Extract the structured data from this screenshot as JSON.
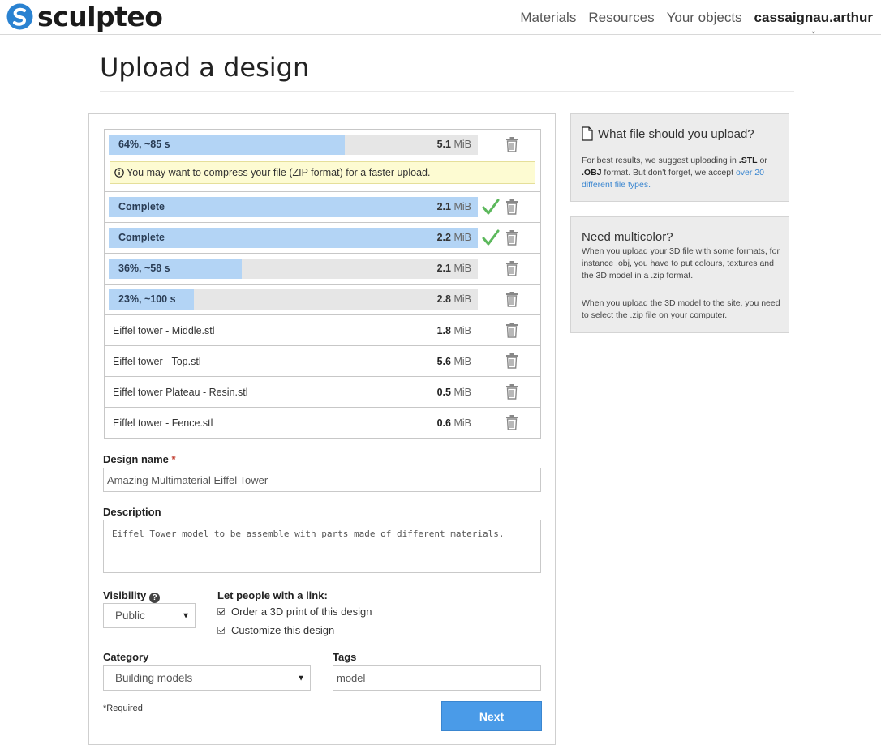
{
  "brand": {
    "name": "sculpteo",
    "color": "#2a82d1"
  },
  "nav": {
    "items": [
      "Materials",
      "Resources",
      "Your objects"
    ],
    "user": "cassaignau.arthur"
  },
  "page": {
    "title": "Upload a design"
  },
  "files": [
    {
      "status": "64%, ~85 s",
      "size_num": "5.1",
      "size_unit": "MiB",
      "progress": 0.64,
      "warning": "You may want to compress your file (ZIP format) for a faster upload."
    },
    {
      "status": "Complete",
      "size_num": "2.1",
      "size_unit": "MiB",
      "progress": 1.0,
      "done": true
    },
    {
      "status": "Complete",
      "size_num": "2.2",
      "size_unit": "MiB",
      "progress": 1.0,
      "done": true
    },
    {
      "status": "36%, ~58 s",
      "size_num": "2.1",
      "size_unit": "MiB",
      "progress": 0.36
    },
    {
      "status": "23%, ~100 s",
      "size_num": "2.8",
      "size_unit": "MiB",
      "progress": 0.23
    },
    {
      "name": "Eiffel tower - Middle.stl",
      "size_num": "1.8",
      "size_unit": "MiB"
    },
    {
      "name": "Eiffel tower - Top.stl",
      "size_num": "5.6",
      "size_unit": "MiB"
    },
    {
      "name": "Eiffel tower Plateau - Resin.stl",
      "size_num": "0.5",
      "size_unit": "MiB"
    },
    {
      "name": "Eiffel tower - Fence.stl",
      "size_num": "0.6",
      "size_unit": "MiB"
    }
  ],
  "form": {
    "design_name_label": "Design name",
    "required_mark": "*",
    "design_name_value": "Amazing Multimaterial Eiffel Tower",
    "description_label": "Description",
    "description_value": "Eiffel Tower model to be assemble with parts made of different materials.",
    "visibility_label": "Visibility",
    "visibility_value": "Public",
    "link_label": "Let people with a link:",
    "option_order": "Order a 3D print of this design",
    "option_customize": "Customize this design",
    "category_label": "Category",
    "category_value": "Building models",
    "tags_label": "Tags",
    "tags_value": "model",
    "required_note": "*Required",
    "next_label": "Next"
  },
  "side": {
    "box1_title": "What file should you upload?",
    "box1_text_a": "For best results, we suggest uploading in ",
    "box1_stl": ".STL",
    "box1_text_b": " or ",
    "box1_obj": ".OBJ",
    "box1_text_c": " format. But don't forget, we accept ",
    "box1_link": "over 20 different file types.",
    "box2_title": "Need multicolor?",
    "box2_p1": "When you upload your 3D file with some formats, for instance .obj, you have to put colours, textures and the 3D model in a .zip format.",
    "box2_p2": "When you upload the 3D model to the site, you need to select the .zip file on your computer."
  }
}
